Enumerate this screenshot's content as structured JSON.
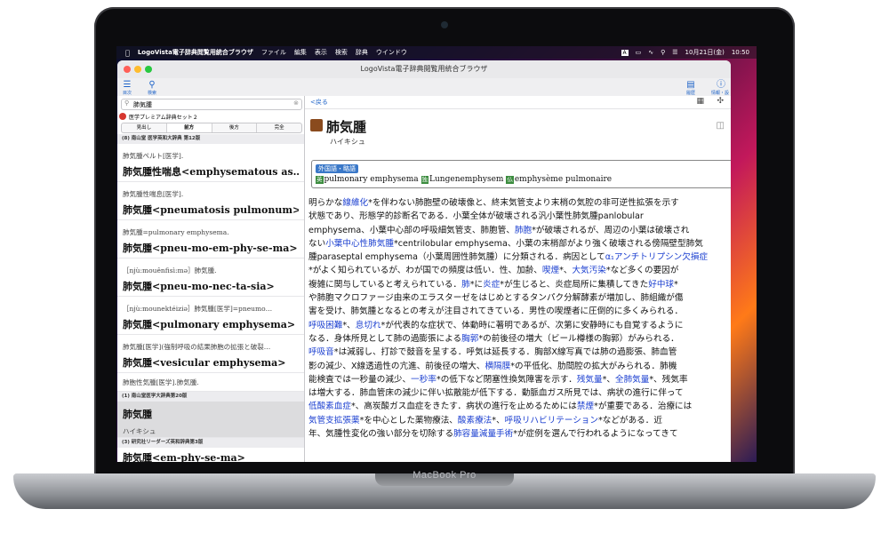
{
  "device": {
    "label": "MacBook Pro"
  },
  "menubar": {
    "app": "LogoVista電子辞典閲覧用統合ブラウザ",
    "items": [
      "ファイル",
      "編集",
      "表示",
      "検索",
      "辞典",
      "ウインドウ"
    ],
    "clock": "10月21日(金)",
    "time": "10:50"
  },
  "window": {
    "title": "LogoVista電子辞典閲覧用統合ブラウザ",
    "toolbar": {
      "menu_label": "目次",
      "search_label": "検索",
      "history_label": "履歴",
      "info_label": "情報・設定"
    }
  },
  "left": {
    "search_value": "肺気腫",
    "dict_set": "医学プレミアム辞典セット２",
    "modes": [
      "見出し",
      "前方",
      "後方",
      "完全"
    ],
    "selected_mode": "前方",
    "results": [
      {
        "type": "header",
        "text": "(8) 南山堂 医学英和大辞典 第12版"
      },
      {
        "type": "entry",
        "sub": "肺気腫ペルト[医学].",
        "main": "肺気腫性喘息<emphysematous as…"
      },
      {
        "type": "entry",
        "sub": "肺気腫性喘息[医学].",
        "main": "肺気腫<pneumatosis pulmonum>"
      },
      {
        "type": "entry",
        "sub": "肺気腫=pulmonary emphysema.",
        "main": "肺気腫<pneu-mo-em-phy-se-ma>"
      },
      {
        "type": "entry",
        "sub": "［njù:mouênfisì:mə］肺気腫.",
        "main": "肺気腫<pneu-mo-nec-ta-sia>"
      },
      {
        "type": "entry",
        "sub": "［njù:mounektéiziə］肺気腫[医学]=pneumo…",
        "main": "肺気腫<pulmonary emphysema>"
      },
      {
        "type": "entry",
        "sub": "肺気腫[医学](強制呼吸の結果肺胞の拡張と破裂…",
        "main": "肺気腫<vesicular emphysema>"
      },
      {
        "type": "entry",
        "sub": "肺胞性気腫[医学].肺気腫.",
        "main": ""
      },
      {
        "type": "header",
        "text": "(1) 南山堂医学大辞典第20版"
      },
      {
        "type": "selected",
        "main": "肺気腫",
        "sub": "ハイキシュ"
      },
      {
        "type": "header",
        "text": "(3) 研究社リーダーズ英和辞典第3版"
      },
      {
        "type": "entry",
        "sub": "",
        "main": "肺気腫<em-phy-se-ma>"
      }
    ]
  },
  "right": {
    "back": "<戻る",
    "headword": "肺気腫",
    "reading": "ハイキシュ",
    "foreign_label": "外国語・略語",
    "foreign": [
      {
        "lang": "英",
        "text": "pulmonary emphysema"
      },
      {
        "lang": "独",
        "text": "Lungenemphysem"
      },
      {
        "lang": "仏",
        "text": "emphysème pulmonaire"
      }
    ],
    "body_lines": [
      [
        {
          "t": "明らかな"
        },
        {
          "t": "線維化",
          "l": true
        },
        {
          "t": "*を伴わない肺胞壁の破壊像と、終末気管支より末梢の気腔の非可逆性拡張を示す"
        }
      ],
      [
        {
          "t": "状態であり、形態学的診断名である．小葉全体が破壊される汎小葉性肺気腫panlobular"
        }
      ],
      [
        {
          "t": "emphysema、小葉中心部の呼吸細気管支、肺胞管、"
        },
        {
          "t": "肺胞",
          "l": true
        },
        {
          "t": "*が破壊されるが、周辺の小葉は破壊され"
        }
      ],
      [
        {
          "t": "ない"
        },
        {
          "t": "小葉中心性肺気腫",
          "l": true
        },
        {
          "t": "*centrilobular emphysema、小葉の末梢部がより強く破壊される傍隔壁型肺気"
        }
      ],
      [
        {
          "t": "腫paraseptal emphysema（小葉周囲性肺気腫）に分類される．病因として"
        },
        {
          "t": "α₁アンチトリプシン欠損症",
          "l": true
        }
      ],
      [
        {
          "t": "*がよく知られているが、わが国での頻度は低い．性、加齢、"
        },
        {
          "t": "喫煙",
          "l": true
        },
        {
          "t": "*、"
        },
        {
          "t": "大気汚染",
          "l": true
        },
        {
          "t": "*など多くの要因が"
        }
      ],
      [
        {
          "t": "複雑に関与していると考えられている．"
        },
        {
          "t": "肺",
          "l": true
        },
        {
          "t": "*に"
        },
        {
          "t": "炎症",
          "l": true
        },
        {
          "t": "*が生じると、炎症局所に集積してきた"
        },
        {
          "t": "好中球",
          "l": true
        },
        {
          "t": "*"
        }
      ],
      [
        {
          "t": "や肺胞マクロファージ由来のエラスターゼをはじめとするタンパク分解酵素が増加し、肺組織が傷"
        }
      ],
      [
        {
          "t": "害を受け、肺気腫となるとの考えが注目されてきている．男性の喫煙者に圧倒的に多くみられる．"
        }
      ],
      [
        {
          "t": "呼吸困難",
          "l": true
        },
        {
          "t": "*、"
        },
        {
          "t": "息切れ",
          "l": true
        },
        {
          "t": "*が代表的な症状で、体動時に著明であるが、次第に安静時にも自覚するように"
        }
      ],
      [
        {
          "t": "なる．身体所見として肺の過膨張による"
        },
        {
          "t": "胸郭",
          "l": true
        },
        {
          "t": "*の前後径の増大（ビール樽様の胸郭）がみられる．"
        }
      ],
      [
        {
          "t": "呼吸音",
          "l": true
        },
        {
          "t": "*は減弱し、打診で鼓音を呈する．呼気は延長する．胸部X線写真では肺の過膨張、肺血管"
        }
      ],
      [
        {
          "t": "影の減少、X線透過性の亢進、前後径の増大、"
        },
        {
          "t": "横隔膜",
          "l": true
        },
        {
          "t": "*の平低化、肋間腔の拡大がみられる．肺機"
        }
      ],
      [
        {
          "t": "能検査では一秒量の減少、"
        },
        {
          "t": "一秒率",
          "l": true
        },
        {
          "t": "*の低下など閉塞性換気障害を示す．"
        },
        {
          "t": "残気量",
          "l": true
        },
        {
          "t": "*、"
        },
        {
          "t": "全肺気量",
          "l": true
        },
        {
          "t": "*、残気率"
        }
      ],
      [
        {
          "t": "は増大する．肺血管床の減少に伴い拡散能が低下する．動脈血ガス所見では、病状の進行に伴って"
        }
      ],
      [
        {
          "t": "低酸素血症",
          "l": true
        },
        {
          "t": "*、高炭酸ガス血症をきたす．病状の進行を止めるためには"
        },
        {
          "t": "禁煙",
          "l": true
        },
        {
          "t": "*が重要である．治療には"
        }
      ],
      [
        {
          "t": "気管支拡張薬",
          "l": true
        },
        {
          "t": "*を中心とした薬物療法、"
        },
        {
          "t": "酸素療法",
          "l": true
        },
        {
          "t": "*、"
        },
        {
          "t": "呼吸リハビリテーション",
          "l": true
        },
        {
          "t": "*などがある．近"
        }
      ],
      [
        {
          "t": "年、気腫性変化の強い部分を切除する"
        },
        {
          "t": "肺容量減量手術",
          "l": true
        },
        {
          "t": "*が症例を選んで行われるようになってきて"
        }
      ]
    ]
  },
  "colors": {
    "link": "#1b3fd0",
    "accent": "#1e63c8",
    "lang_badge": "#3b8c3e"
  }
}
